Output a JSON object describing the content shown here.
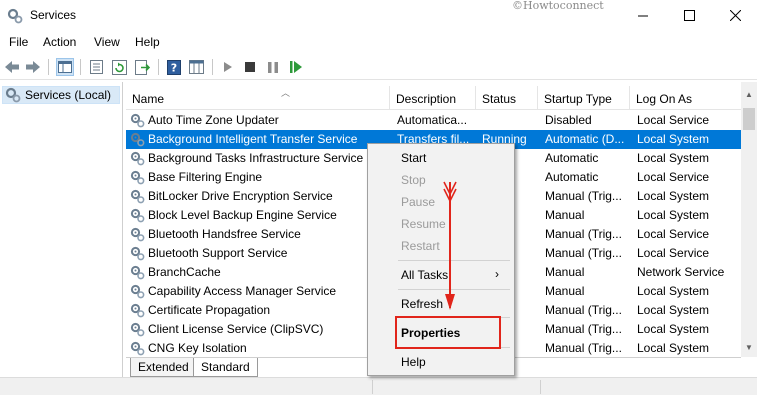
{
  "window": {
    "title": "Services",
    "watermark": "©Howtoconnect"
  },
  "menubar": {
    "items": [
      "File",
      "Action",
      "View",
      "Help"
    ]
  },
  "tree": {
    "root_label": "Services (Local)"
  },
  "list": {
    "columns": [
      "Name",
      "Description",
      "Status",
      "Startup Type",
      "Log On As"
    ],
    "rows": [
      {
        "name": "Auto Time Zone Updater",
        "description": "Automatica...",
        "status": "",
        "startup": "Disabled",
        "logon": "Local Service"
      },
      {
        "name": "Background Intelligent Transfer Service",
        "description": "Transfers fil...",
        "status": "Running",
        "startup": "Automatic (D...",
        "logon": "Local System"
      },
      {
        "name": "Background Tasks Infrastructure Service",
        "description": "",
        "status": "nning",
        "startup": "Automatic",
        "logon": "Local System"
      },
      {
        "name": "Base Filtering Engine",
        "description": "",
        "status": "nning",
        "startup": "Automatic",
        "logon": "Local Service"
      },
      {
        "name": "BitLocker Drive Encryption Service",
        "description": "",
        "status": "",
        "startup": "Manual (Trig...",
        "logon": "Local System"
      },
      {
        "name": "Block Level Backup Engine Service",
        "description": "",
        "status": "",
        "startup": "Manual",
        "logon": "Local System"
      },
      {
        "name": "Bluetooth Handsfree Service",
        "description": "",
        "status": "",
        "startup": "Manual (Trig...",
        "logon": "Local Service"
      },
      {
        "name": "Bluetooth Support Service",
        "description": "",
        "status": "nning",
        "startup": "Manual (Trig...",
        "logon": "Local Service"
      },
      {
        "name": "BranchCache",
        "description": "",
        "status": "",
        "startup": "Manual",
        "logon": "Network Service"
      },
      {
        "name": "Capability Access Manager Service",
        "description": "",
        "status": "",
        "startup": "Manual",
        "logon": "Local System"
      },
      {
        "name": "Certificate Propagation",
        "description": "",
        "status": "",
        "startup": "Manual (Trig...",
        "logon": "Local System"
      },
      {
        "name": "Client License Service (ClipSVC)",
        "description": "",
        "status": "",
        "startup": "Manual (Trig...",
        "logon": "Local System"
      },
      {
        "name": "CNG Key Isolation",
        "description": "",
        "status": "nning",
        "startup": "Manual (Trig...",
        "logon": "Local System"
      }
    ]
  },
  "tabs": {
    "extended": "Extended",
    "standard": "Standard"
  },
  "context_menu": {
    "start": "Start",
    "stop": "Stop",
    "pause": "Pause",
    "resume": "Resume",
    "restart": "Restart",
    "all_tasks": "All Tasks",
    "all_tasks_arrow": "›",
    "refresh": "Refresh",
    "properties": "Properties",
    "help": "Help"
  },
  "colors": {
    "selection": "#0078d7",
    "highlight_box": "#e1251b",
    "annotation_arrow": "#e1251b"
  },
  "icons": [
    "services-icon",
    "minimize-icon",
    "maximize-icon",
    "close-icon",
    "back-icon",
    "forward-icon",
    "console-tree-icon",
    "properties-icon",
    "refresh-icon",
    "export-icon",
    "help-icon",
    "view-icon",
    "play-icon",
    "stop-icon",
    "pause-icon",
    "resume-icon",
    "gear-icon"
  ]
}
